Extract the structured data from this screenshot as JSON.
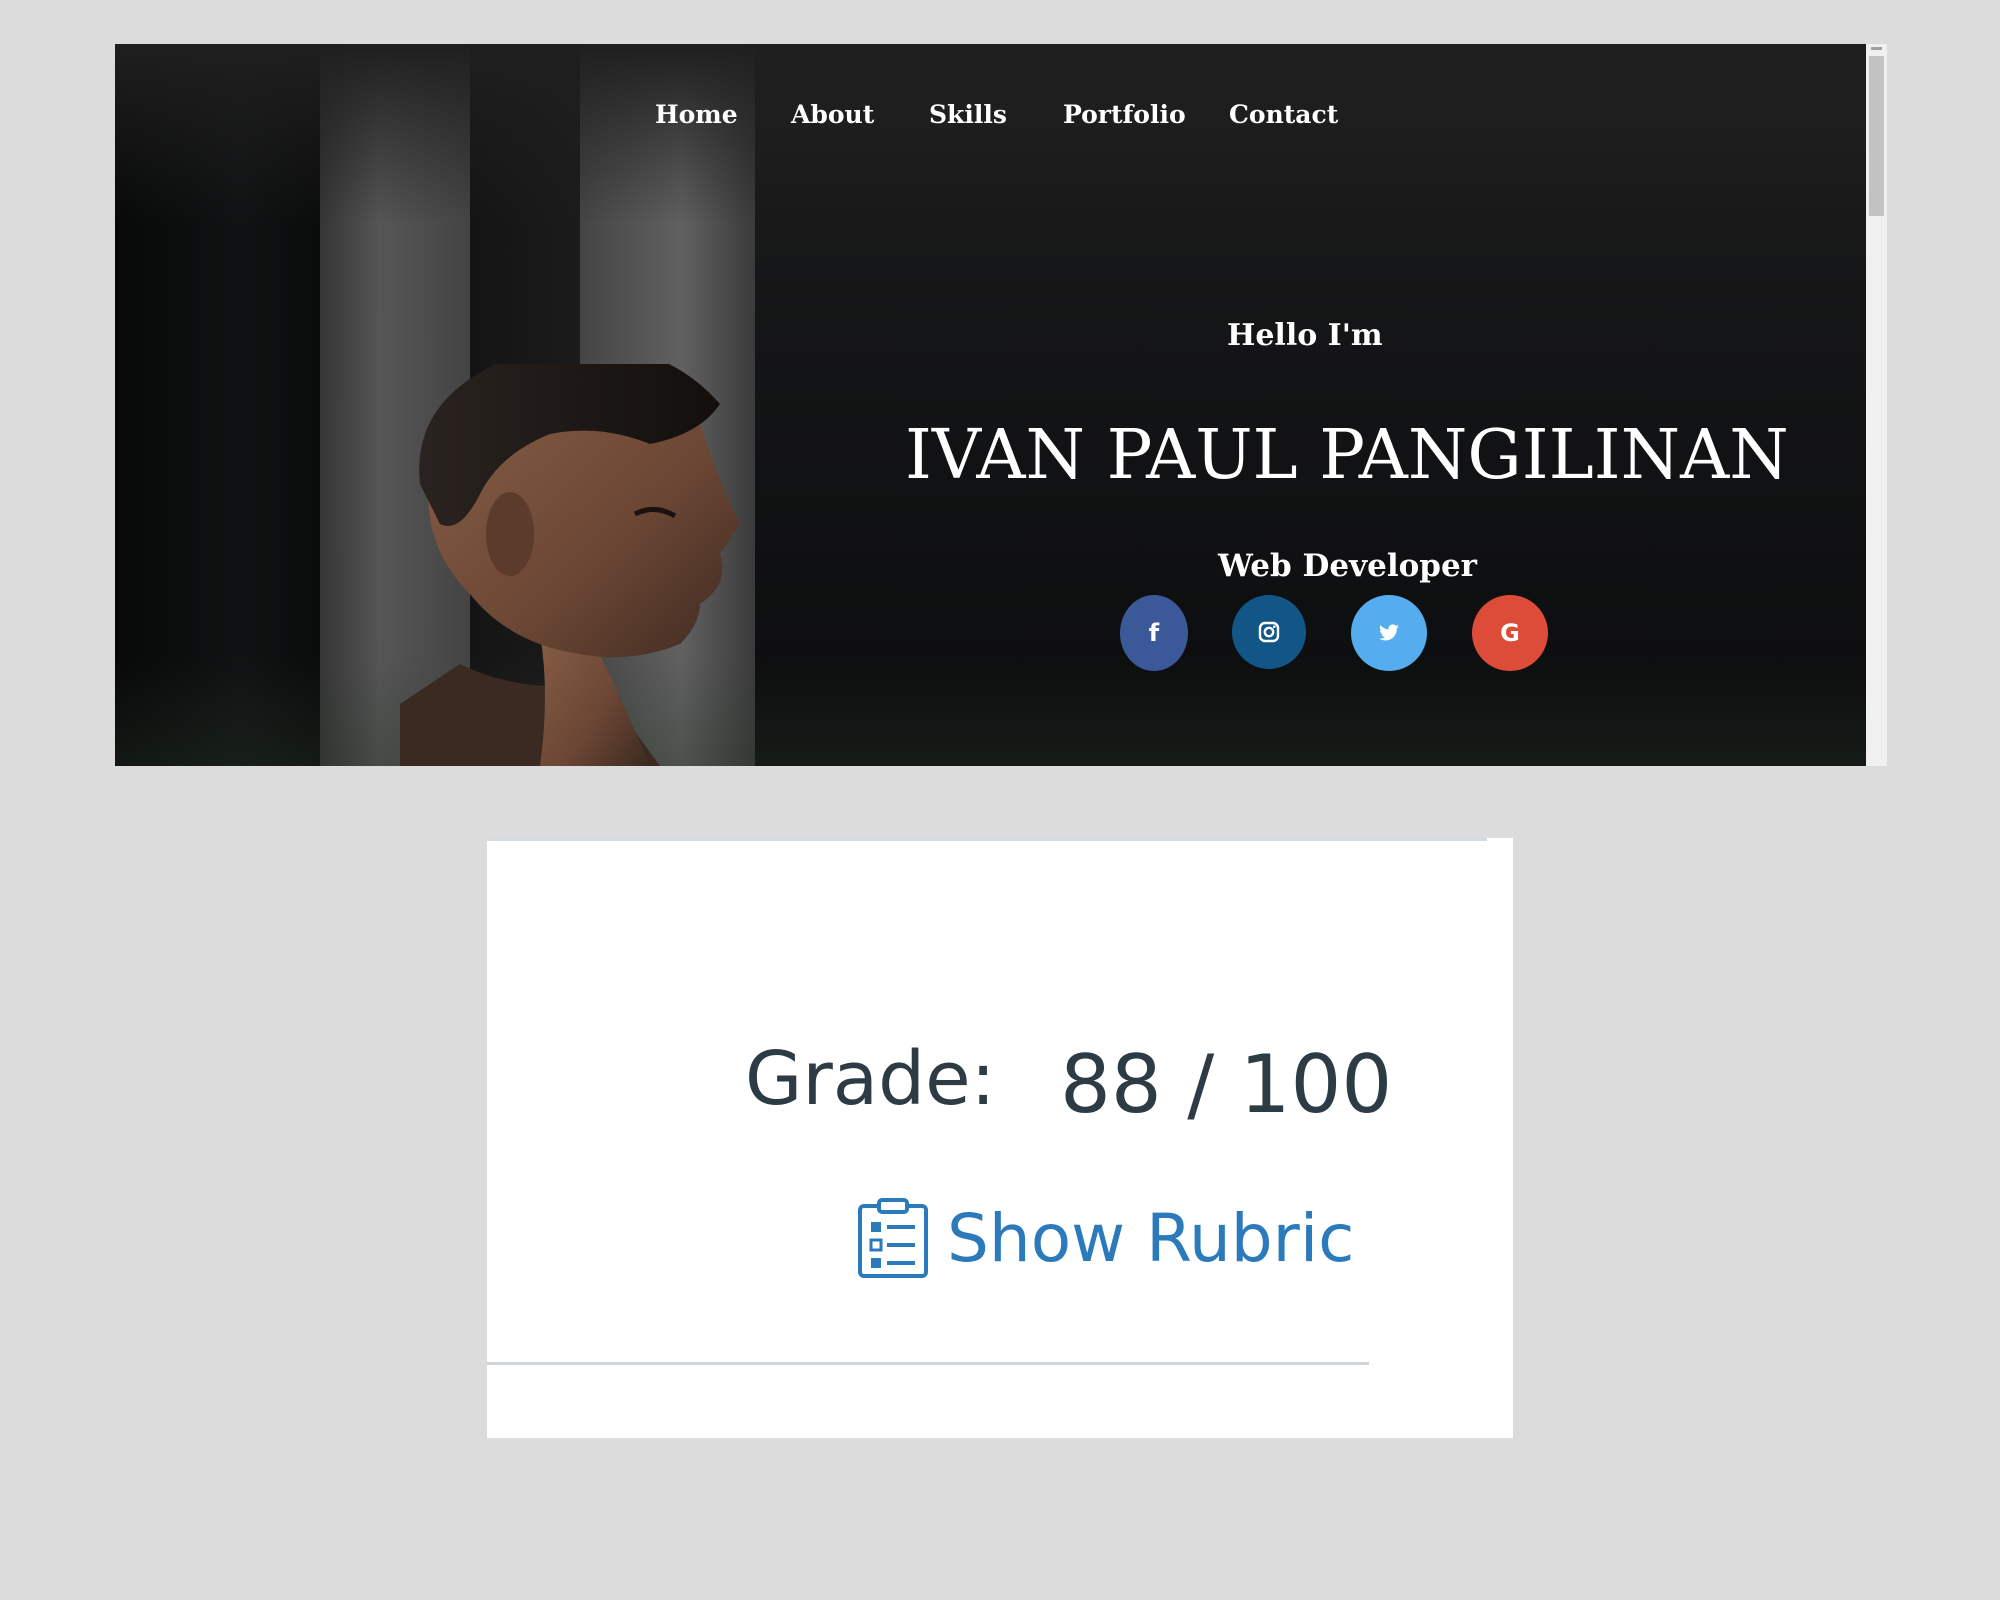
{
  "nav": {
    "items": [
      "Home",
      "About",
      "Skills",
      "Portfolio",
      "Contact"
    ]
  },
  "hero": {
    "greeting": "Hello I'm",
    "name": "IVAN PAUL PANGILINAN",
    "role": "Web Developer"
  },
  "social": [
    {
      "name": "facebook-icon",
      "glyph": "f",
      "color": "#3b5998"
    },
    {
      "name": "instagram-icon",
      "glyph": "◎",
      "color": "#125688"
    },
    {
      "name": "twitter-icon",
      "glyph": "🐦",
      "color": "#55acee"
    },
    {
      "name": "google-icon",
      "glyph": "G",
      "color": "#dd4b39"
    }
  ],
  "grade": {
    "label": "Grade:",
    "value": "88 / 100",
    "score": 88,
    "max": 100,
    "rubric_label": "Show Rubric"
  },
  "colors": {
    "page_bg": "#dcdcdc",
    "rubric_link": "#2b7abc",
    "grade_text": "#2d3b45"
  }
}
